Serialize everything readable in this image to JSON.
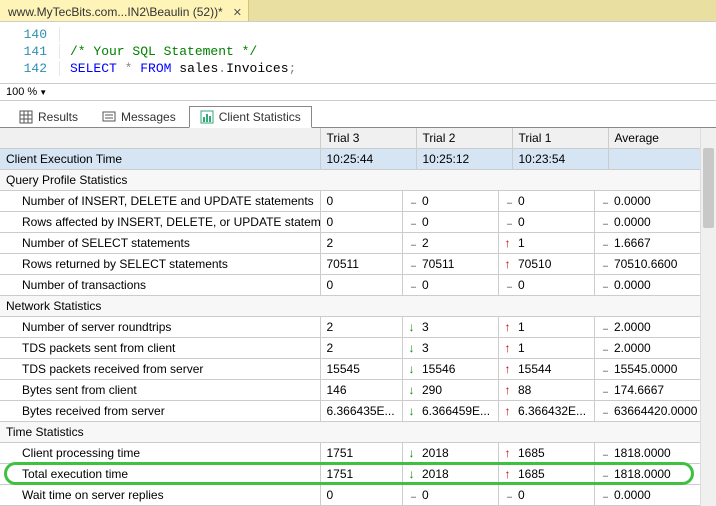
{
  "file_tab": {
    "title": "www.MyTecBits.com...IN2\\Beaulin (52))*"
  },
  "editor": {
    "lines": [
      {
        "num": "140",
        "comment": "",
        "kw": "",
        "rest": ""
      },
      {
        "num": "141",
        "comment": "/* Your SQL Statement */",
        "kw": "",
        "rest": ""
      },
      {
        "num": "142",
        "comment": "",
        "kw": "SELECT",
        "rest": "sales.Invoices;"
      }
    ]
  },
  "zoom": {
    "value": "100 %"
  },
  "result_tabs": {
    "results": "Results",
    "messages": "Messages",
    "client_stats": "Client Statistics"
  },
  "headers": {
    "label": "",
    "trial3": "Trial  3",
    "trial2": "Trial  2",
    "trial1": "Trial  1",
    "average": "Average"
  },
  "sections": {
    "exec_time_label": "Client Execution Time",
    "exec_time": {
      "t3": "10:25:44",
      "t2": "10:25:12",
      "t1": "10:23:54",
      "avg": ""
    },
    "query_profile": "Query Profile Statistics",
    "network": "Network Statistics",
    "time": "Time Statistics"
  },
  "rows": [
    {
      "label": "Number of INSERT, DELETE and UPDATE statements",
      "t3": "0",
      "a3": "r",
      "t2": "0",
      "a2": "r",
      "t1": "0",
      "a1": "r",
      "avg": "0.0000"
    },
    {
      "label": "Rows affected by INSERT, DELETE, or UPDATE stateme...",
      "t3": "0",
      "a3": "r",
      "t2": "0",
      "a2": "r",
      "t1": "0",
      "a1": "r",
      "avg": "0.0000"
    },
    {
      "label": "Number of SELECT statements",
      "t3": "2",
      "a3": "r",
      "t2": "2",
      "a2": "u",
      "t1": "1",
      "a1": "r",
      "avg": "1.6667"
    },
    {
      "label": "Rows returned by SELECT statements",
      "t3": "70511",
      "a3": "r",
      "t2": "70511",
      "a2": "u",
      "t1": "70510",
      "a1": "r",
      "avg": "70510.6600"
    },
    {
      "label": "Number of transactions",
      "t3": "0",
      "a3": "r",
      "t2": "0",
      "a2": "r",
      "t1": "0",
      "a1": "r",
      "avg": "0.0000"
    }
  ],
  "net_rows": [
    {
      "label": "Number of server roundtrips",
      "t3": "2",
      "a3": "d",
      "t2": "3",
      "a2": "u",
      "t1": "1",
      "a1": "r",
      "avg": "2.0000"
    },
    {
      "label": "TDS packets sent from client",
      "t3": "2",
      "a3": "d",
      "t2": "3",
      "a2": "u",
      "t1": "1",
      "a1": "r",
      "avg": "2.0000"
    },
    {
      "label": "TDS packets received from server",
      "t3": "15545",
      "a3": "d",
      "t2": "15546",
      "a2": "u",
      "t1": "15544",
      "a1": "r",
      "avg": "15545.0000"
    },
    {
      "label": "Bytes sent from client",
      "t3": "146",
      "a3": "d",
      "t2": "290",
      "a2": "u",
      "t1": "88",
      "a1": "r",
      "avg": "174.6667"
    },
    {
      "label": "Bytes received from server",
      "t3": "6.366435E...",
      "a3": "d",
      "t2": "6.366459E...",
      "a2": "u",
      "t1": "6.366432E...",
      "a1": "r",
      "avg": "63664420.0000"
    }
  ],
  "time_rows": [
    {
      "label": "Client processing time",
      "t3": "1751",
      "a3": "d",
      "t2": "2018",
      "a2": "u",
      "t1": "1685",
      "a1": "r",
      "avg": "1818.0000"
    },
    {
      "label": "Total execution time",
      "t3": "1751",
      "a3": "d",
      "t2": "2018",
      "a2": "u",
      "t1": "1685",
      "a1": "r",
      "avg": "1818.0000"
    },
    {
      "label": "Wait time on server replies",
      "t3": "0",
      "a3": "r",
      "t2": "0",
      "a2": "r",
      "t1": "0",
      "a1": "r",
      "avg": "0.0000"
    }
  ]
}
